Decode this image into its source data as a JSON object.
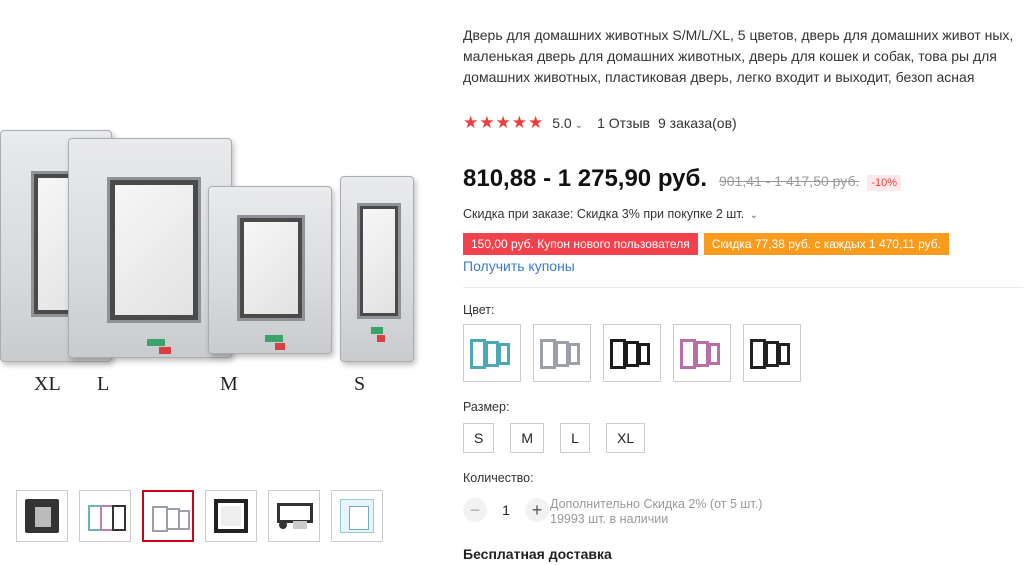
{
  "product": {
    "title": "Дверь для домашних животных S/M/L/XL, 5 цветов, дверь для домашних живот ных, маленькая дверь для домашних животных, дверь для кошек и собак, това ры для домашних животных, пластиковая дверь, легко входит и выходит, безоп асная",
    "rating": "5.0",
    "stars": "★★★★★",
    "reviews": "1 Отзыв",
    "orders": "9 заказа(ов)"
  },
  "price": {
    "current": "810,88 - 1 275,90 руб.",
    "old": "901,41 - 1 417,50 руб.",
    "discount": "-10%"
  },
  "order_discount": "Скидка при заказе: Скидка 3% при покупке 2 шт.",
  "coupons": {
    "new_user": "150,00 руб. Купон нового пользователя",
    "store": "Скидка 77,38 руб. с каждых 1 470,11 руб.",
    "get_label": "Получить купоны"
  },
  "gallery": {
    "size_labels": [
      "XL",
      "L",
      "M",
      "S"
    ],
    "thumbs": [
      "cat-door-photo",
      "colored-doors",
      "grey-doors",
      "black-door",
      "door-parts",
      "packaging-box"
    ]
  },
  "color": {
    "label": "Цвет:",
    "options": [
      "teal",
      "grey",
      "black",
      "pink",
      "black-white"
    ]
  },
  "size": {
    "label": "Размер:",
    "options": [
      "S",
      "M",
      "L",
      "XL"
    ]
  },
  "quantity": {
    "label": "Количество:",
    "value": "1",
    "minus": "−",
    "plus": "+",
    "note": "Дополнительно Скидка 2% (от 5 шт.)",
    "stock": "19993 шт. в наличии"
  },
  "shipping": "Бесплатная доставка",
  "colors": {
    "star": "#f23b3b",
    "coupon_red": "#f2424d",
    "coupon_orange": "#f99b1c",
    "link": "#3a7bd5",
    "active_thumb": "#d0021b"
  }
}
